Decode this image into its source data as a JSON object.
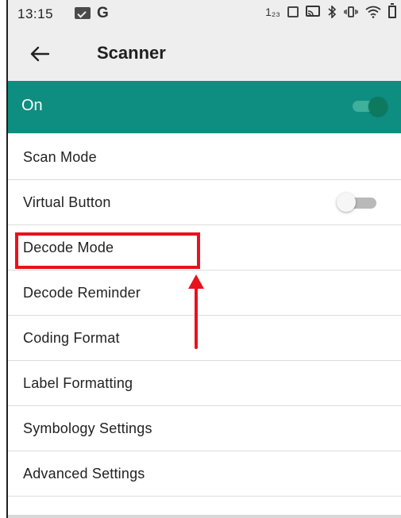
{
  "status_bar": {
    "time": "13:15",
    "icons": [
      "message-icon",
      "google-icon",
      "data-saver-icon",
      "screen-icon",
      "cast-icon",
      "bluetooth-icon",
      "vibrate-icon",
      "wifi-icon",
      "battery-icon"
    ],
    "g_glyph": "G",
    "data_saver_glyph": "1₂₃"
  },
  "app_bar": {
    "title": "Scanner",
    "back_icon": "arrow-left-icon"
  },
  "master_switch": {
    "label": "On",
    "state": "on",
    "color": "#0e8e80"
  },
  "settings": [
    {
      "label": "Scan Mode"
    },
    {
      "label": "Virtual Button",
      "toggle": "off"
    },
    {
      "label": "Decode Mode",
      "highlighted": true
    },
    {
      "label": "Decode Reminder"
    },
    {
      "label": "Coding Format"
    },
    {
      "label": "Label Formatting"
    },
    {
      "label": "Symbology Settings"
    },
    {
      "label": "Advanced Settings"
    }
  ],
  "annotation": {
    "highlight_color": "#e8121c"
  }
}
